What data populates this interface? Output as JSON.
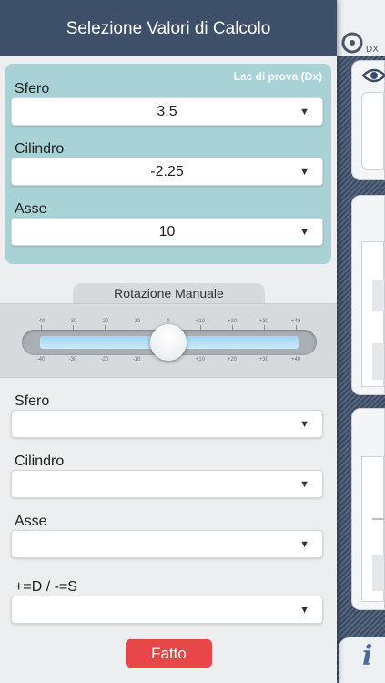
{
  "header": {
    "title": "Selezione Valori di Calcolo"
  },
  "prova": {
    "tag": "Lac di prova (Dx)",
    "fields": [
      {
        "label": "Sfero",
        "value": "3.5"
      },
      {
        "label": "Cilindro",
        "value": "-2.25"
      },
      {
        "label": "Asse",
        "value": "10"
      }
    ]
  },
  "rotation": {
    "title": "Rotazione Manuale",
    "scale": [
      "-40",
      "-30",
      "-20",
      "-10",
      "0",
      "+10",
      "+20",
      "+30",
      "+40"
    ],
    "value": 0
  },
  "manual": {
    "fields": [
      {
        "label": "Sfero",
        "value": ""
      },
      {
        "label": "Cilindro",
        "value": ""
      },
      {
        "label": "Asse",
        "value": ""
      },
      {
        "label": "+=D / -=S",
        "value": ""
      }
    ]
  },
  "dropdown_arrow": "▼",
  "done_button": "Fatto",
  "side": {
    "eye_label": "DX",
    "info_glyph": "i"
  },
  "colors": {
    "header": "#3e5069",
    "prova_box": "#a9d2d6",
    "done": "#e8474a"
  }
}
